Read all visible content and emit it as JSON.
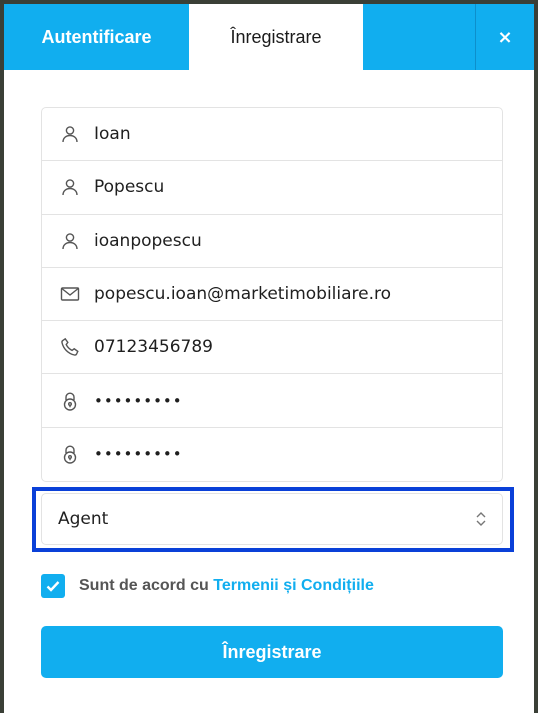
{
  "tabs": {
    "login_label": "Autentificare",
    "register_label": "Înregistrare",
    "close_label": "×"
  },
  "form": {
    "fields": [
      {
        "icon": "user-icon",
        "value": "Ioan"
      },
      {
        "icon": "user-icon",
        "value": "Popescu"
      },
      {
        "icon": "user-icon",
        "value": "ioanpopescu"
      },
      {
        "icon": "envelope-icon",
        "value": "popescu.ioan@marketimobiliare.ro"
      },
      {
        "icon": "phone-icon",
        "value": "07123456789"
      },
      {
        "icon": "lock-icon",
        "value": "•••••••••"
      },
      {
        "icon": "lock-icon",
        "value": "•••••••••"
      }
    ],
    "account_type": {
      "selected": "Agent"
    },
    "terms": {
      "checked": true,
      "prefix": "Sunt de acord cu",
      "link": "Termenii și Condițiile"
    },
    "submit_label": "Înregistrare"
  },
  "colors": {
    "accent": "#11aeef",
    "highlight": "#0a40d8"
  }
}
